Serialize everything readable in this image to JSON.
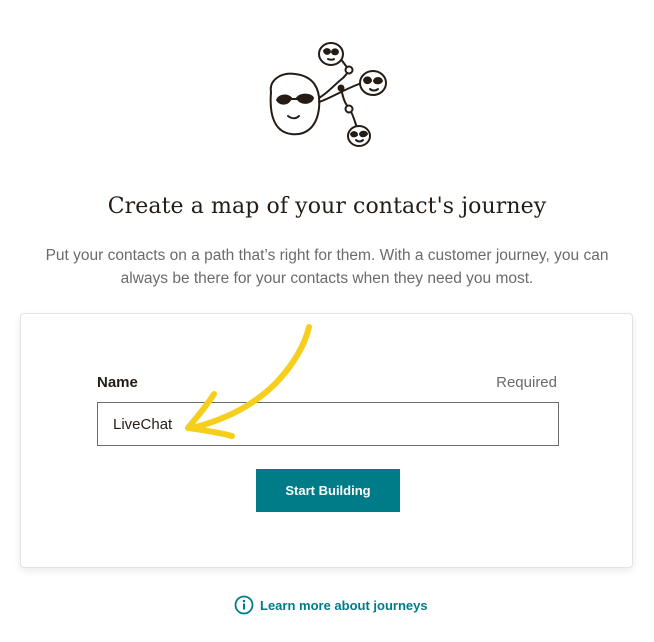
{
  "header": {
    "illustration_icon": "journey-map-faces-icon",
    "title": "Create a map of your contact's journey",
    "description": "Put your contacts on a path that’s right for them. With a customer journey, you can always be there for your contacts when they need you most."
  },
  "form": {
    "name_label": "Name",
    "required_label": "Required",
    "name_value": "LiveChat",
    "submit_label": "Start Building"
  },
  "footer": {
    "learn_more_label": "Learn more about journeys",
    "learn_more_icon": "info-icon"
  },
  "annotation": {
    "arrow_icon": "yellow-arrow-icon",
    "arrow_color": "#f5cf1b"
  },
  "colors": {
    "accent": "#007c89",
    "text": "#241c15",
    "muted": "#6b6b6b"
  }
}
